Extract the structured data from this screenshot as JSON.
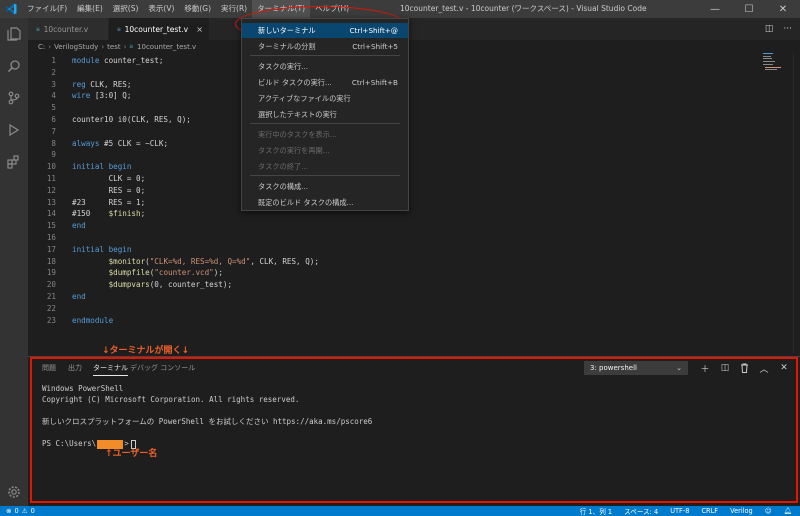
{
  "titlebar": {
    "menus": [
      "ファイル(F)",
      "編集(E)",
      "選択(S)",
      "表示(V)",
      "移動(G)",
      "実行(R)",
      "ターミナル(T)",
      "ヘルプ(H)"
    ],
    "window_title": "10counter_test.v - 10counter (ワークスペース) - Visual Studio Code"
  },
  "tabs": [
    {
      "label": "10counter.v",
      "icon": "verilog-file-icon"
    },
    {
      "label": "10counter_test.v",
      "icon": "verilog-file-icon",
      "close": "×"
    }
  ],
  "breadcrumb": [
    "C:",
    "VerilogStudy",
    "test",
    "10counter_test.v"
  ],
  "editor": {
    "lines": [
      {
        "n": "1",
        "html": "<span class=\"kw\">module</span> counter_test;"
      },
      {
        "n": "2",
        "html": ""
      },
      {
        "n": "3",
        "html": "<span class=\"kw\">reg</span> CLK, RES;"
      },
      {
        "n": "4",
        "html": "<span class=\"kw\">wire</span> [3:0] Q;"
      },
      {
        "n": "5",
        "html": ""
      },
      {
        "n": "6",
        "html": "counter10 i0(CLK, RES, Q);"
      },
      {
        "n": "7",
        "html": ""
      },
      {
        "n": "8",
        "html": "<span class=\"kw\">always</span> #5 CLK = ~CLK;"
      },
      {
        "n": "9",
        "html": ""
      },
      {
        "n": "10",
        "html": "<span class=\"kw\">initial</span> <span class=\"kw\">begin</span>"
      },
      {
        "n": "11",
        "html": "        CLK = 0;"
      },
      {
        "n": "12",
        "html": "        RES = 0;"
      },
      {
        "n": "13",
        "html": "#23     RES = 1;"
      },
      {
        "n": "14",
        "html": "#150    <span class=\"sys\">$finish</span>;"
      },
      {
        "n": "15",
        "html": "<span class=\"kw\">end</span>"
      },
      {
        "n": "16",
        "html": ""
      },
      {
        "n": "17",
        "html": "<span class=\"kw\">initial</span> <span class=\"kw\">begin</span>"
      },
      {
        "n": "18",
        "html": "        <span class=\"sys\">$monitor</span>(<span class=\"str\">\"CLK=%d, RES=%d, Q=%d\"</span>, CLK, RES, Q);"
      },
      {
        "n": "19",
        "html": "        <span class=\"sys\">$dumpfile</span>(<span class=\"str\">\"counter.vcd\"</span>);"
      },
      {
        "n": "20",
        "html": "        <span class=\"sys\">$dumpvars</span>(0, counter_test);"
      },
      {
        "n": "21",
        "html": "<span class=\"kw\">end</span>"
      },
      {
        "n": "22",
        "html": ""
      },
      {
        "n": "23",
        "html": "<span class=\"kw\">endmodule</span>"
      }
    ]
  },
  "dropdown": {
    "items": [
      {
        "label": "新しいターミナル",
        "shortcut": "Ctrl+Shift+@",
        "state": "selected"
      },
      {
        "label": "ターミナルの分割",
        "shortcut": "Ctrl+Shift+5",
        "state": "normal"
      },
      {
        "label": "タスクの実行...",
        "shortcut": "",
        "state": "normal"
      },
      {
        "label": "ビルド タスクの実行...",
        "shortcut": "Ctrl+Shift+B",
        "state": "normal"
      },
      {
        "label": "アクティブなファイルの実行",
        "shortcut": "",
        "state": "normal"
      },
      {
        "label": "選択したテキストの実行",
        "shortcut": "",
        "state": "normal"
      },
      {
        "label": "実行中のタスクを表示...",
        "shortcut": "",
        "state": "disabled"
      },
      {
        "label": "タスクの実行を再開...",
        "shortcut": "",
        "state": "disabled"
      },
      {
        "label": "タスクの終了...",
        "shortcut": "",
        "state": "disabled"
      },
      {
        "label": "タスクの構成...",
        "shortcut": "",
        "state": "normal"
      },
      {
        "label": "既定のビルド タスクの構成...",
        "shortcut": "",
        "state": "normal"
      }
    ]
  },
  "panel": {
    "annotation_top": "↓ターミナルが開く↓",
    "tabs": [
      "問題",
      "出力",
      "ターミナル",
      "デバッグ コンソール"
    ],
    "shell": "3: powershell",
    "terminal_lines": [
      "Windows PowerShell",
      "Copyright (C) Microsoft Corporation. All rights reserved.",
      "",
      "新しいクロスプラットフォームの PowerShell をお試しください https://aka.ms/pscore6",
      ""
    ],
    "prompt_prefix": "PS C:\\Users\\",
    "prompt_suffix": ">",
    "annotation_user": "↑ユーザー名"
  },
  "statusbar": {
    "errors": "0",
    "warnings": "0",
    "position": "行 1、列 1",
    "spaces": "スペース: 4",
    "encoding": "UTF-8",
    "eol": "CRLF",
    "language": "Verilog"
  },
  "colors": {
    "accent": "#007acc",
    "annotation": "#e51400",
    "selection": "#094771"
  }
}
